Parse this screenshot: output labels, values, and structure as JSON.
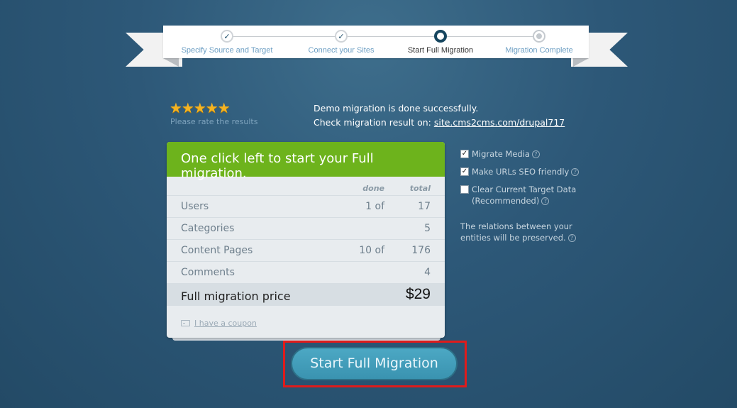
{
  "steps": [
    {
      "label": "Specify Source and Target",
      "state": "done"
    },
    {
      "label": "Connect your Sites",
      "state": "done"
    },
    {
      "label": "Start Full Migration",
      "state": "current"
    },
    {
      "label": "Migration Complete",
      "state": "future"
    }
  ],
  "rating": {
    "stars": "★★★★★",
    "value": 5,
    "max": 5,
    "caption": "Please rate the results"
  },
  "demo": {
    "line1": "Demo migration is done successfully.",
    "line2_prefix": "Check migration result on: ",
    "link": "site.cms2cms.com/drupal717"
  },
  "card": {
    "header": "One click left to start your Full migration.",
    "col_done": "done",
    "col_total": "total",
    "rows": [
      {
        "name": "Users",
        "done": "1 of",
        "total": "17"
      },
      {
        "name": "Categories",
        "done": "",
        "total": "5"
      },
      {
        "name": "Content Pages",
        "done": "10 of",
        "total": "176"
      },
      {
        "name": "Comments",
        "done": "",
        "total": "4"
      }
    ],
    "price_label": "Full migration price",
    "price": "$29",
    "coupon": "I have a coupon"
  },
  "options": [
    {
      "label": "Migrate Media",
      "checked": true
    },
    {
      "label": "Make URLs SEO friendly",
      "checked": true
    },
    {
      "label": "Clear Current Target Data (Recommended)",
      "checked": false
    }
  ],
  "note": "The relations between your entities will be preserved.",
  "help_glyph": "?",
  "check_glyph": "✓",
  "cta": "Start Full Migration"
}
